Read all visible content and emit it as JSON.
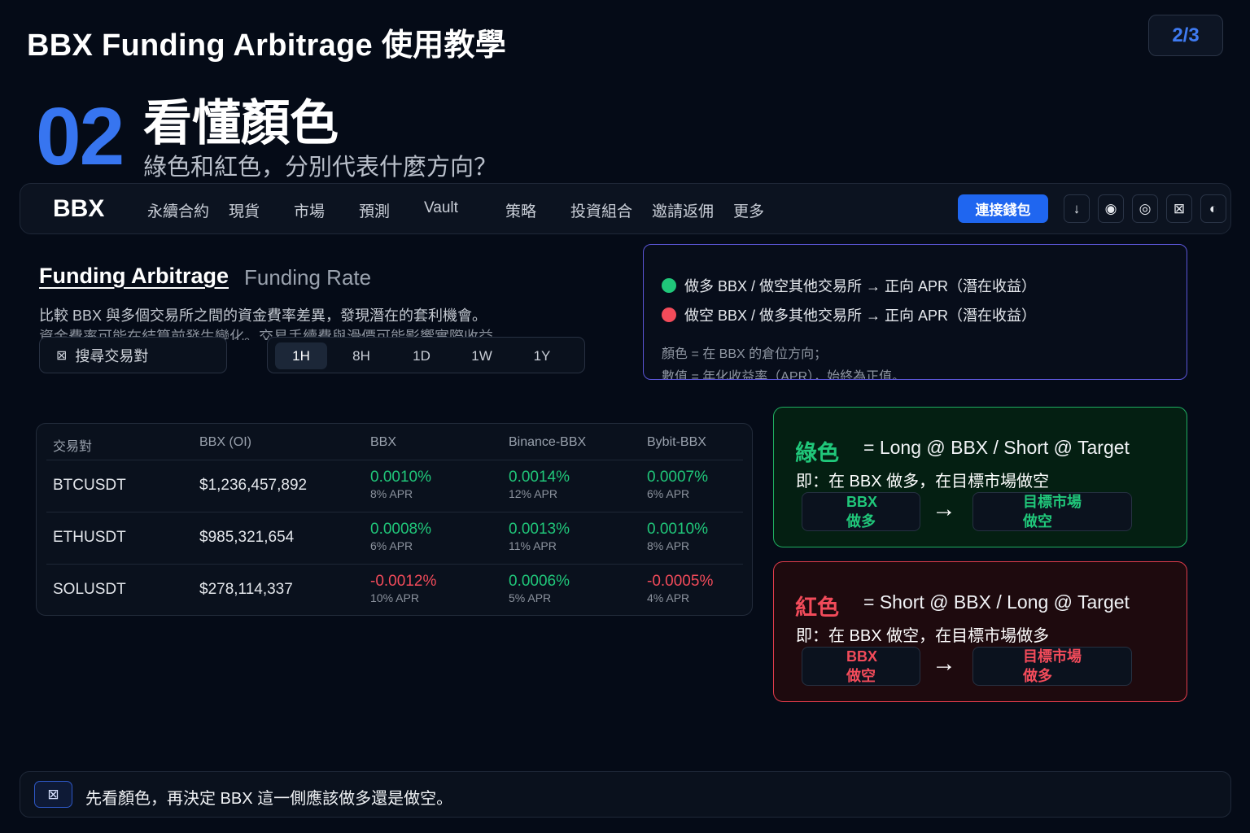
{
  "header": {
    "title": "BBX Funding Arbitrage 使用教學",
    "page_indicator": "2/3"
  },
  "section": {
    "number": "02",
    "title": "看懂顏色",
    "subtitle": "綠色和紅色，分別代表什麼方向？"
  },
  "navbar": {
    "logo": "BBX",
    "items": [
      "永續合約",
      "現貨",
      "市場",
      "預測",
      "Vault",
      "策略",
      "投資組合",
      "邀請返佣",
      "更多"
    ],
    "connect_label": "連接錢包",
    "icons": [
      "↓",
      "◉",
      "◎",
      "⊠",
      "◐"
    ]
  },
  "page": {
    "title": "Funding Arbitrage",
    "tab": "Funding Rate",
    "description": "比較 BBX 與多個交易所之間的資金費率差異，發現潛在的套利機會。",
    "description2": "資金費率可能在結算前發生變化。交易手續費與滑價可能影響實際收益。",
    "search_placeholder": "搜尋交易對",
    "periods": [
      "1H",
      "8H",
      "1D",
      "1W",
      "1Y"
    ],
    "active_period": "1H"
  },
  "legend": {
    "green_text": "做多 BBX / 做空其他交易所 → 正向 APR（潛在收益）",
    "red_text": "做空 BBX / 做多其他交易所 → 正向 APR（潛在收益）",
    "note1": "顏色 = 在 BBX 的倉位方向；",
    "note2": "數值 = 年化收益率（APR），始終為正值。",
    "green_color": "#20c77a",
    "red_color": "#f24b5a"
  },
  "table": {
    "headers": [
      "交易對",
      "BBX (OI)",
      "BBX",
      "Binance-BBX",
      "Bybit-BBX"
    ],
    "rows": [
      {
        "pair": "BTCUSDT",
        "oi": "$1,236,457,892",
        "bbx": {
          "rate": "0.0010%",
          "apr": "8% APR",
          "dir": "pos"
        },
        "binance": {
          "rate": "0.0014%",
          "apr": "12% APR",
          "dir": "pos"
        },
        "bybit": {
          "rate": "0.0007%",
          "apr": "6% APR",
          "dir": "pos"
        }
      },
      {
        "pair": "ETHUSDT",
        "oi": "$985,321,654",
        "bbx": {
          "rate": "0.0008%",
          "apr": "6% APR",
          "dir": "pos"
        },
        "binance": {
          "rate": "0.0013%",
          "apr": "11% APR",
          "dir": "pos"
        },
        "bybit": {
          "rate": "0.0010%",
          "apr": "8% APR",
          "dir": "pos"
        }
      },
      {
        "pair": "SOLUSDT",
        "oi": "$278,114,337",
        "bbx": {
          "rate": "-0.0012%",
          "apr": "10% APR",
          "dir": "neg"
        },
        "binance": {
          "rate": "0.0006%",
          "apr": "5% APR",
          "dir": "pos"
        },
        "bybit": {
          "rate": "-0.0005%",
          "apr": "4% APR",
          "dir": "neg"
        }
      }
    ]
  },
  "explain": {
    "green": {
      "name": "綠色",
      "formula": "= Long @ BBX / Short @ Target",
      "meaning": "即：在 BBX 做多，在目標市場做空",
      "chip1_line1": "BBX",
      "chip1_line2": "做多",
      "arrow": "→",
      "chip2_line1": "目標市場",
      "chip2_line2": "做空"
    },
    "red": {
      "name": "紅色",
      "formula": "= Short @ BBX / Long @ Target",
      "meaning": "即：在 BBX 做空，在目標市場做多",
      "chip1_line1": "BBX",
      "chip1_line2": "做空",
      "arrow": "→",
      "chip2_line1": "目標市場",
      "chip2_line2": "做多"
    }
  },
  "tip": {
    "icon": "⊠",
    "text": "先看顏色，再決定 BBX 這一側應該做多還是做空。"
  }
}
